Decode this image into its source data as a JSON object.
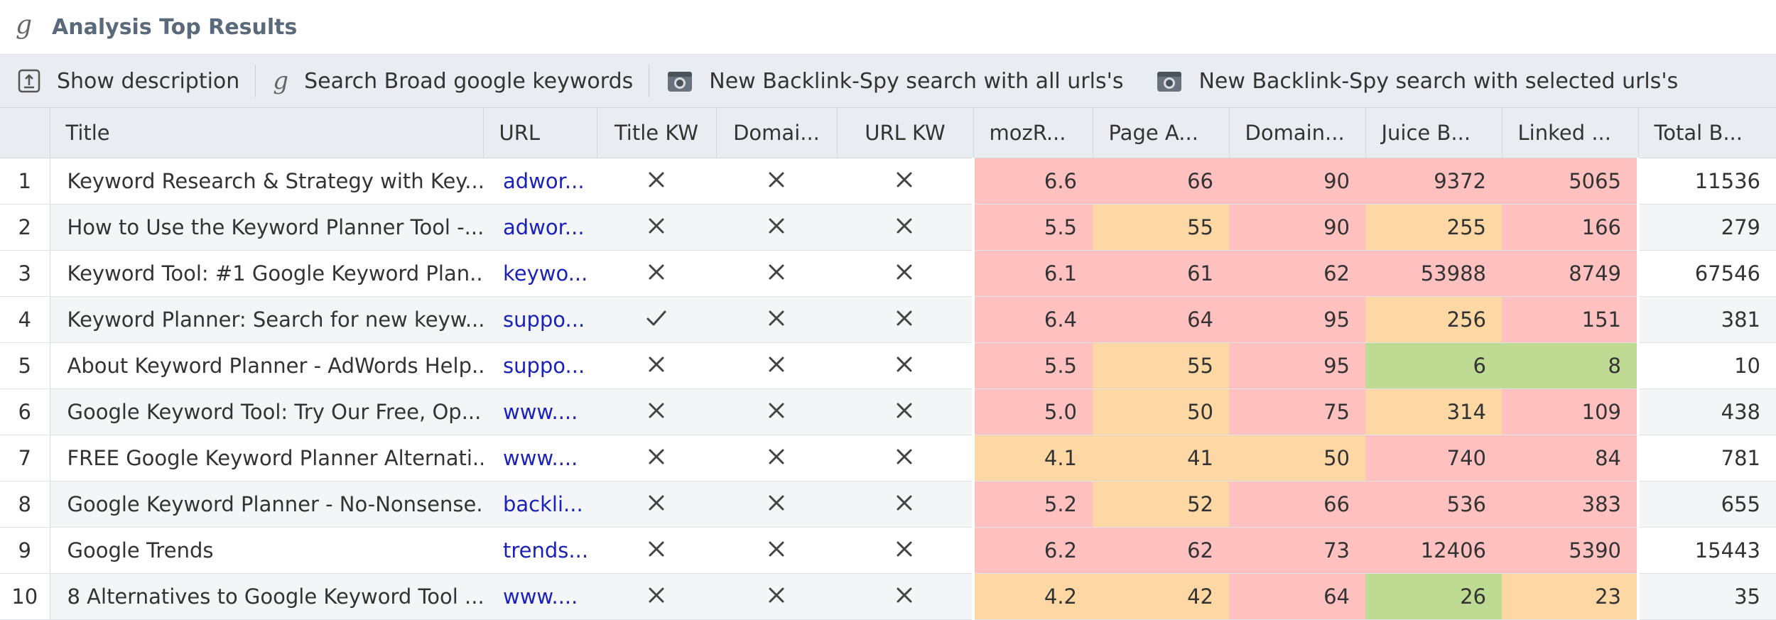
{
  "panel": {
    "title": "Analysis Top Results",
    "icon": "google-g-icon"
  },
  "toolbar": {
    "show_description": "Show description",
    "search_broad": "Search Broad google keywords",
    "backlink_all": "New Backlink-Spy search with all urls's",
    "backlink_selected": "New Backlink-Spy search with selected urls's"
  },
  "columns": [
    "Title",
    "URL",
    "Title KW",
    "Domai...",
    "URL KW",
    "mozR...",
    "Page A...",
    "Domain...",
    "Juice B...",
    "Linked ...",
    "Total B..."
  ],
  "colors": {
    "red": "#ffc0c0",
    "orange": "#fdd8a4",
    "green": "#bfda92",
    "link": "#1a22b8"
  },
  "rows": [
    {
      "n": "1",
      "title": "Keyword Research & Strategy with Key...",
      "url": "adwor...",
      "tkw": "x",
      "dkw": "x",
      "ukw": "x",
      "moz": "6.6",
      "pa": "66",
      "da": "90",
      "juice": "9372",
      "linked": "5065",
      "total": "11536",
      "c": [
        "red",
        "red",
        "red",
        "red",
        "red"
      ]
    },
    {
      "n": "2",
      "title": "How to Use the Keyword Planner Tool -...",
      "url": "adwor...",
      "tkw": "x",
      "dkw": "x",
      "ukw": "x",
      "moz": "5.5",
      "pa": "55",
      "da": "90",
      "juice": "255",
      "linked": "166",
      "total": "279",
      "c": [
        "red",
        "orange",
        "red",
        "orange",
        "red"
      ]
    },
    {
      "n": "3",
      "title": "Keyword Tool: #1 Google Keyword Plan...",
      "url": "keywo...",
      "tkw": "x",
      "dkw": "x",
      "ukw": "x",
      "moz": "6.1",
      "pa": "61",
      "da": "62",
      "juice": "53988",
      "linked": "8749",
      "total": "67546",
      "c": [
        "red",
        "red",
        "red",
        "red",
        "red"
      ]
    },
    {
      "n": "4",
      "title": "Keyword Planner: Search for new keyw...",
      "url": "suppo...",
      "tkw": "check",
      "dkw": "x",
      "ukw": "x",
      "moz": "6.4",
      "pa": "64",
      "da": "95",
      "juice": "256",
      "linked": "151",
      "total": "381",
      "c": [
        "red",
        "red",
        "red",
        "orange",
        "red"
      ]
    },
    {
      "n": "5",
      "title": "About Keyword Planner - AdWords Help...",
      "url": "suppo...",
      "tkw": "x",
      "dkw": "x",
      "ukw": "x",
      "moz": "5.5",
      "pa": "55",
      "da": "95",
      "juice": "6",
      "linked": "8",
      "total": "10",
      "c": [
        "red",
        "orange",
        "red",
        "green",
        "green"
      ]
    },
    {
      "n": "6",
      "title": "Google Keyword Tool: Try Our Free, Op...",
      "url": "www....",
      "tkw": "x",
      "dkw": "x",
      "ukw": "x",
      "moz": "5.0",
      "pa": "50",
      "da": "75",
      "juice": "314",
      "linked": "109",
      "total": "438",
      "c": [
        "red",
        "orange",
        "red",
        "orange",
        "red"
      ]
    },
    {
      "n": "7",
      "title": "FREE Google Keyword Planner Alternati...",
      "url": "www....",
      "tkw": "x",
      "dkw": "x",
      "ukw": "x",
      "moz": "4.1",
      "pa": "41",
      "da": "50",
      "juice": "740",
      "linked": "84",
      "total": "781",
      "c": [
        "orange",
        "orange",
        "orange",
        "red",
        "red"
      ]
    },
    {
      "n": "8",
      "title": "Google Keyword Planner - No-Nonsense...",
      "url": "backli...",
      "tkw": "x",
      "dkw": "x",
      "ukw": "x",
      "moz": "5.2",
      "pa": "52",
      "da": "66",
      "juice": "536",
      "linked": "383",
      "total": "655",
      "c": [
        "red",
        "orange",
        "red",
        "red",
        "red"
      ]
    },
    {
      "n": "9",
      "title": "Google Trends",
      "url": "trends...",
      "tkw": "x",
      "dkw": "x",
      "ukw": "x",
      "moz": "6.2",
      "pa": "62",
      "da": "73",
      "juice": "12406",
      "linked": "5390",
      "total": "15443",
      "c": [
        "red",
        "red",
        "red",
        "red",
        "red"
      ]
    },
    {
      "n": "10",
      "title": "8 Alternatives to Google Keyword Tool ...",
      "url": "www....",
      "tkw": "x",
      "dkw": "x",
      "ukw": "x",
      "moz": "4.2",
      "pa": "42",
      "da": "64",
      "juice": "26",
      "linked": "23",
      "total": "35",
      "c": [
        "orange",
        "orange",
        "red",
        "green",
        "orange"
      ]
    }
  ]
}
